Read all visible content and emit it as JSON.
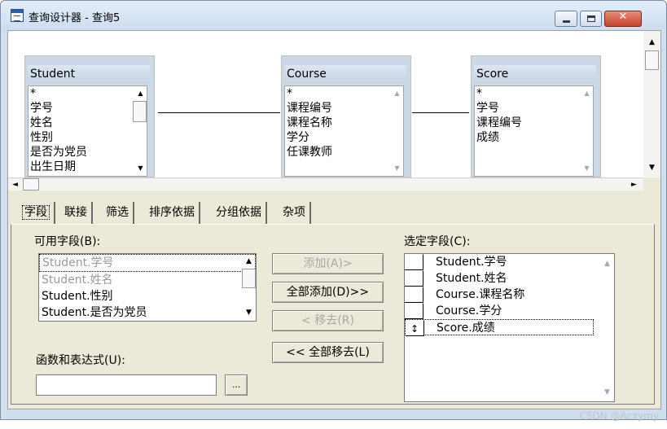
{
  "window": {
    "title": "查询设计器 - 查询5",
    "minimize": "minimize",
    "maximize": "maximize",
    "close": "✕"
  },
  "diagram": {
    "tables": [
      {
        "name": "Student",
        "fields": [
          "*",
          "学号",
          "姓名",
          "性别",
          "是否为党员",
          "出生日期"
        ]
      },
      {
        "name": "Course",
        "fields": [
          "*",
          "课程编号",
          "课程名称",
          "学分",
          "任课教师"
        ]
      },
      {
        "name": "Score",
        "fields": [
          "*",
          "学号",
          "课程编号",
          "成绩"
        ]
      }
    ]
  },
  "tabs": [
    "字段",
    "联接",
    "筛选",
    "排序依据",
    "分组依据",
    "杂项"
  ],
  "fields_tab": {
    "available_label": "可用字段(B):",
    "available": [
      {
        "text": "Student.学号",
        "enabled": false
      },
      {
        "text": "Student.姓名",
        "enabled": false
      },
      {
        "text": "Student.性别",
        "enabled": true
      },
      {
        "text": "Student.是否为党员",
        "enabled": true
      }
    ],
    "buttons": {
      "add": "添加(A)>",
      "add_all": "全部添加(D)>>",
      "remove": "< 移去(R)",
      "remove_all": "<< 全部移去(L)"
    },
    "expr_label": "函数和表达式(U):",
    "expr_value": "",
    "expr_builder": "...",
    "selected_label": "选定字段(C):",
    "selected": [
      "Student.学号",
      "Student.姓名",
      "Course.课程名称",
      "Course.学分",
      "Score.成绩"
    ],
    "mover_glyph": "↕"
  },
  "watermark": "CSDN @Acxymy"
}
